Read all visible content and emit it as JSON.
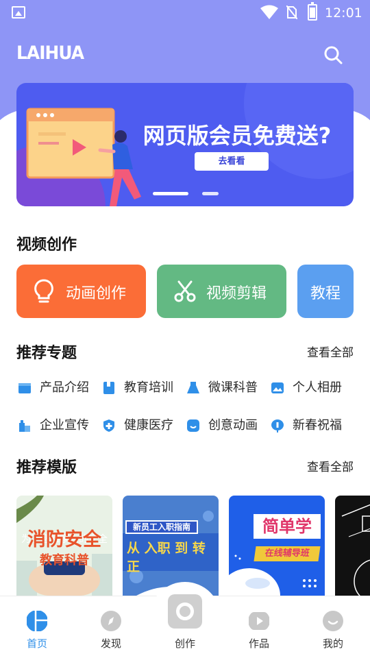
{
  "status_bar": {
    "time": "12:01"
  },
  "header": {
    "logo": "LAIHUA"
  },
  "banner": {
    "title": "网页版会员免费送?",
    "button_label": "去看看"
  },
  "video_creation": {
    "title": "视频创作",
    "cards": [
      {
        "label": "动画创作",
        "color": "#fb6d37",
        "icon": "lightbulb-icon"
      },
      {
        "label": "视频剪辑",
        "color": "#63b983",
        "icon": "scissors-icon"
      },
      {
        "label": "教程",
        "color": "#5b9ff0"
      }
    ]
  },
  "recommended_topics": {
    "title": "推荐专题",
    "see_all": "查看全部",
    "items": [
      {
        "label": "产品介绍",
        "icon": "box-icon"
      },
      {
        "label": "教育培训",
        "icon": "book-icon"
      },
      {
        "label": "微课科普",
        "icon": "flask-icon"
      },
      {
        "label": "个人相册",
        "icon": "photo-icon"
      },
      {
        "label": "企业宣传",
        "icon": "building-icon"
      },
      {
        "label": "健康医疗",
        "icon": "medical-shield-icon"
      },
      {
        "label": "创意动画",
        "icon": "smile-icon"
      },
      {
        "label": "新春祝福",
        "icon": "lantern-icon"
      }
    ]
  },
  "recommended_templates": {
    "title": "推荐模版",
    "see_all": "查看全部",
    "items": [
      {
        "line1": "消防安全",
        "line2": "教育科普"
      },
      {
        "line1": "新员工入职指南",
        "line2": "从 入职 到 转正"
      },
      {
        "line1": "简单学",
        "line2": "在线辅导班"
      },
      {
        "line1": ""
      }
    ]
  },
  "tab_bar": {
    "tabs": [
      {
        "label": "首页",
        "active": true
      },
      {
        "label": "发现"
      },
      {
        "label": "创作"
      },
      {
        "label": "作品"
      },
      {
        "label": "我的"
      }
    ],
    "active_color": "#2f8fe8"
  }
}
